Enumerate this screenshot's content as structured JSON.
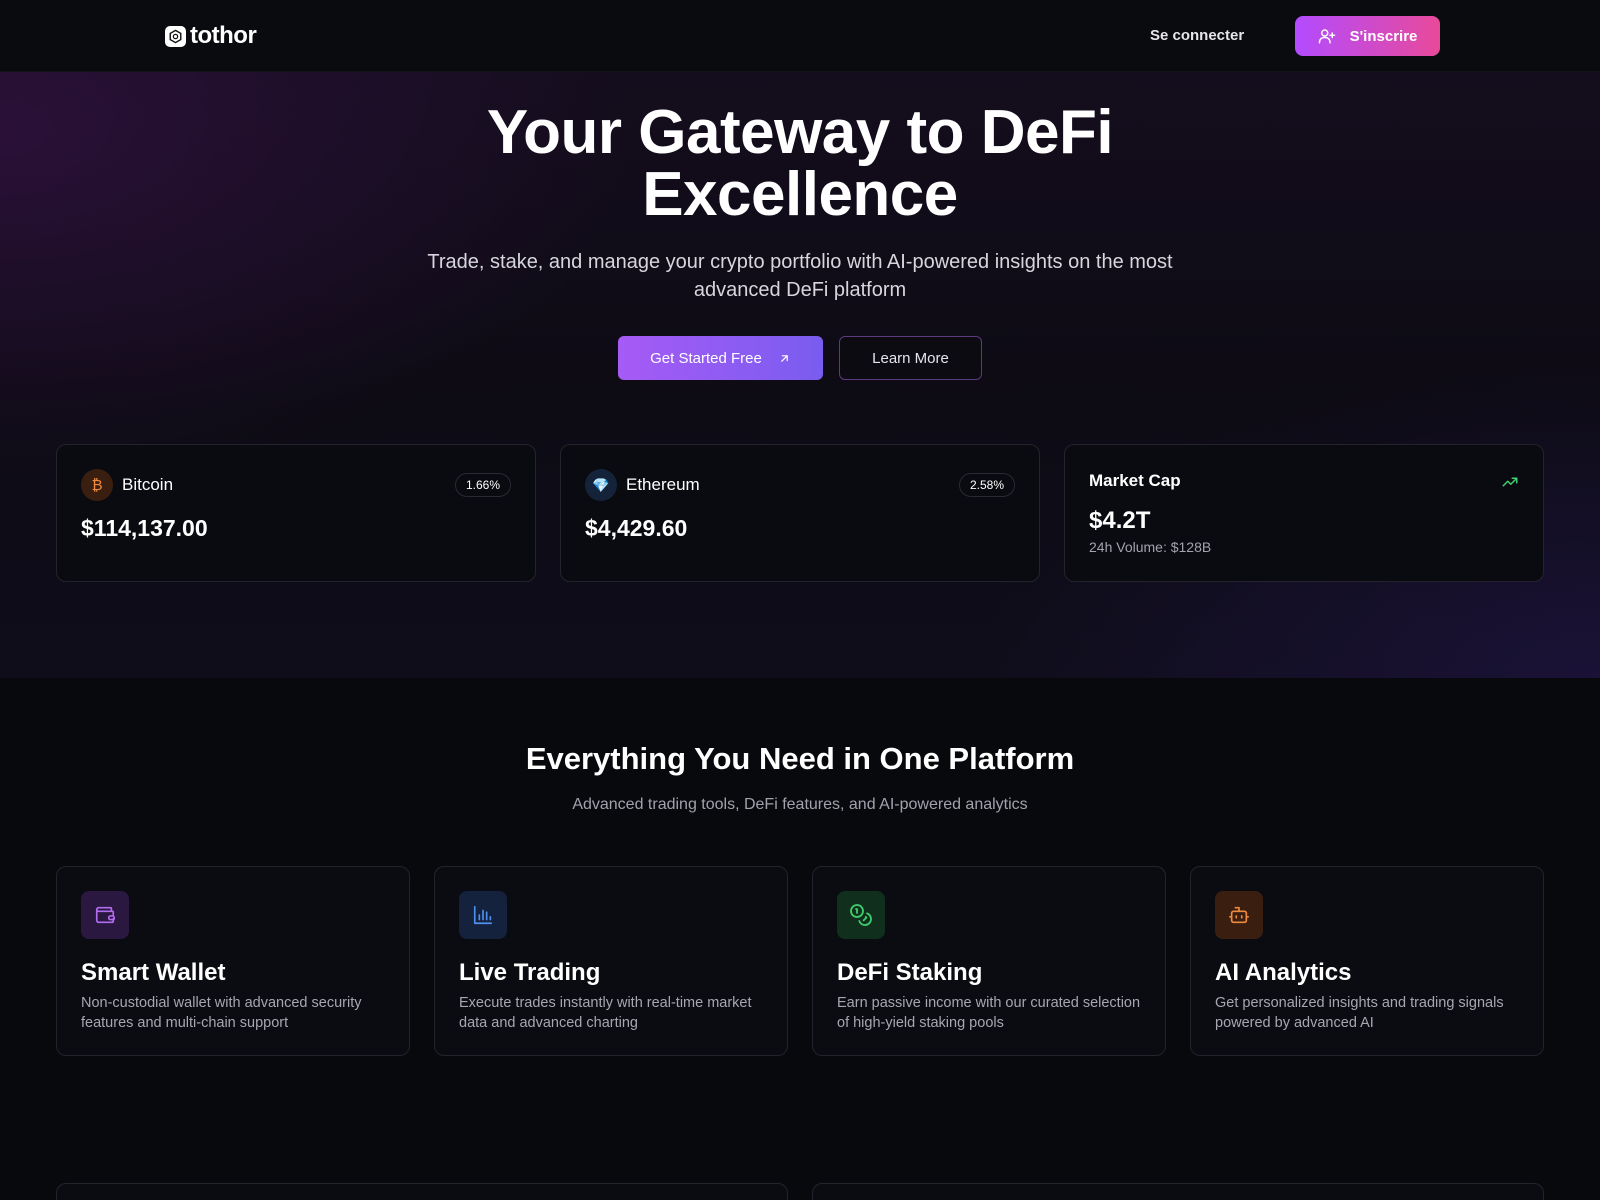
{
  "nav": {
    "brand": "tothor",
    "login_label": "Se connecter",
    "signup_label": "S'inscrire"
  },
  "hero": {
    "title_line1": "Your Gateway to DeFi",
    "title_line2": "Excellence",
    "subtitle_line1": "Trade, stake, and manage your crypto portfolio with AI-powered insights on the most",
    "subtitle_line2": "advanced DeFi platform",
    "primary_cta": "Get Started Free",
    "secondary_cta": "Learn More"
  },
  "market": {
    "bitcoin": {
      "name": "Bitcoin",
      "symbol_glyph": "₿",
      "change": "1.66%",
      "price": "$114,137.00"
    },
    "ethereum": {
      "name": "Ethereum",
      "symbol_glyph": "💎",
      "change": "2.58%",
      "price": "$4,429.60"
    },
    "market_cap": {
      "label": "Market Cap",
      "value": "$4.2T",
      "volume": "24h Volume: $128B"
    }
  },
  "features": {
    "title": "Everything You Need in One Platform",
    "subtitle": "Advanced trading tools, DeFi features, and AI-powered analytics",
    "items": [
      {
        "name": "Smart Wallet",
        "desc": "Non-custodial wallet with advanced security features and multi-chain support",
        "icon": "wallet-icon",
        "color": "#b26cf0"
      },
      {
        "name": "Live Trading",
        "desc": "Execute trades instantly with real-time market data and advanced charting",
        "icon": "bar-chart-icon",
        "color": "#4f8ff0"
      },
      {
        "name": "DeFi Staking",
        "desc": "Earn passive income with our curated selection of high-yield staking pools",
        "icon": "coins-icon",
        "color": "#3fcf6e"
      },
      {
        "name": "AI Analytics",
        "desc": "Get personalized insights and trading signals powered by advanced AI",
        "icon": "robot-icon",
        "color": "#f08a3c"
      }
    ]
  },
  "colors": {
    "accent_purple": "#a65bf5",
    "accent_pink": "#e84a9a",
    "positive_green": "#3fcf6e"
  }
}
